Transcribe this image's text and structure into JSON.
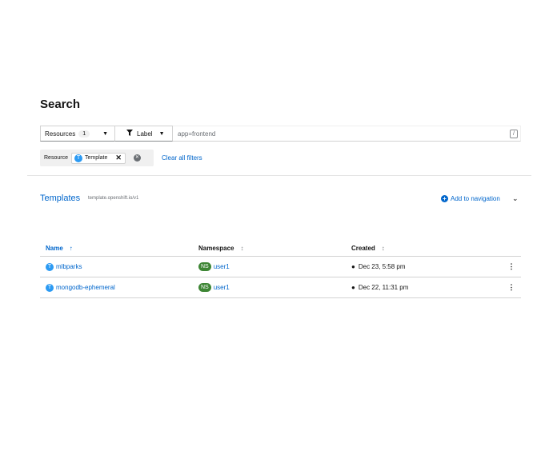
{
  "page": {
    "title": "Search"
  },
  "toolbar": {
    "resources_label": "Resources",
    "resources_count": "1",
    "label_filter": "Label",
    "label_input_value": "app=frontend",
    "shortcut_key": "/"
  },
  "filters": {
    "category": "Resource",
    "chip_badge": "T",
    "chip_label": "Template",
    "clear_all": "Clear all filters"
  },
  "section": {
    "title": "Templates",
    "subtitle": "template.openshift.io/v1",
    "add_nav": "Add to navigation"
  },
  "table": {
    "columns": [
      "Name",
      "Namespace",
      "Created"
    ],
    "rows": [
      {
        "badge": "T",
        "name": "mlbparks",
        "ns_badge": "NS",
        "namespace": "user1",
        "created": "Dec 23, 5:58 pm"
      },
      {
        "badge": "T",
        "name": "mongodb-ephemeral",
        "ns_badge": "NS",
        "namespace": "user1",
        "created": "Dec 22, 11:31 pm"
      }
    ]
  },
  "colors": {
    "link": "#0066cc",
    "ns_badge": "#3e8635",
    "template_badge": "#2b9af3"
  },
  "icons": [
    "filter-icon",
    "caret-down-icon",
    "close-icon",
    "plus-circle-icon",
    "chevron-down-icon",
    "sort-icon",
    "globe-icon",
    "kebab-icon"
  ]
}
